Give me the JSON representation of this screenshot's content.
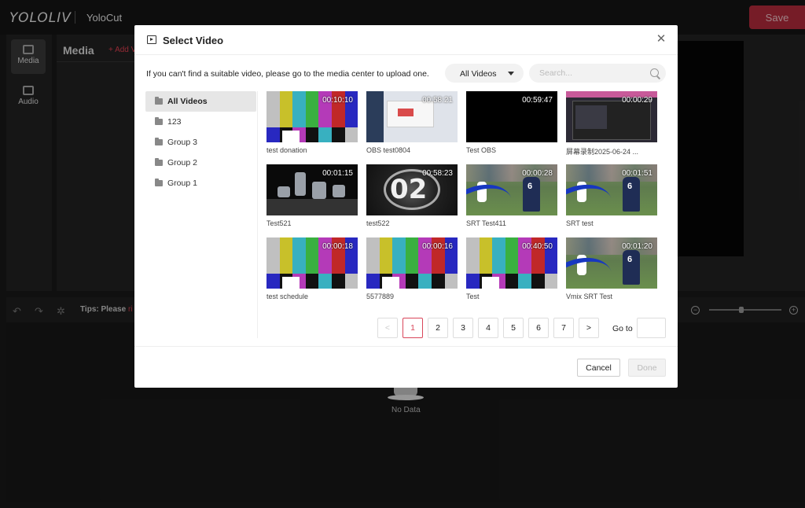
{
  "app": {
    "logo": "YOLOLIV",
    "title": "YoloCut",
    "save_label": "Save"
  },
  "rail": {
    "items": [
      {
        "label": "Media",
        "icon": "clapperboard-icon"
      },
      {
        "label": "Audio",
        "icon": "music-icon"
      }
    ]
  },
  "media_panel": {
    "title": "Media",
    "add_label": "+ Add V"
  },
  "timeline": {
    "tips_prefix": "Tips: Please ",
    "tips_red": "ri",
    "empty_label": "No Data"
  },
  "modal": {
    "title": "Select Video",
    "info": "If you can't find a suitable video, please go to the media center to upload one.",
    "filter_value": "All Videos",
    "search_placeholder": "Search...",
    "folders": [
      "All Videos",
      "123",
      "Group 3",
      "Group 2",
      "Group 1"
    ],
    "videos": [
      {
        "name": "test donation",
        "duration": "00:10:10",
        "thumb": "bars"
      },
      {
        "name": "OBS test0804",
        "duration": "00:58:21",
        "thumb": "obs"
      },
      {
        "name": "Test OBS",
        "duration": "00:59:47",
        "thumb": "black"
      },
      {
        "name": "屏幕录制2025-06-24 ...",
        "duration": "00:00:29",
        "thumb": "screen"
      },
      {
        "name": "Test521",
        "duration": "00:01:15",
        "thumb": "cams"
      },
      {
        "name": "test522",
        "duration": "00:58:23",
        "thumb": "count",
        "thumb_text": "02"
      },
      {
        "name": "SRT Test411",
        "duration": "00:00:28",
        "thumb": "field"
      },
      {
        "name": "SRT test",
        "duration": "00:01:51",
        "thumb": "field"
      },
      {
        "name": "test schedule",
        "duration": "00:00:18",
        "thumb": "bars"
      },
      {
        "name": "5577889",
        "duration": "00:00:16",
        "thumb": "bars"
      },
      {
        "name": "Test",
        "duration": "00:40:50",
        "thumb": "bars"
      },
      {
        "name": "Vmix SRT Test",
        "duration": "00:01:20",
        "thumb": "field"
      }
    ],
    "pagination": {
      "prev": "<",
      "pages": [
        "1",
        "2",
        "3",
        "4",
        "5",
        "6",
        "7"
      ],
      "current": "1",
      "next": ">",
      "goto_label": "Go to"
    },
    "cancel_label": "Cancel",
    "done_label": "Done"
  },
  "colors": {
    "accent": "#d9465a",
    "save_bg": "#b52b3c"
  }
}
